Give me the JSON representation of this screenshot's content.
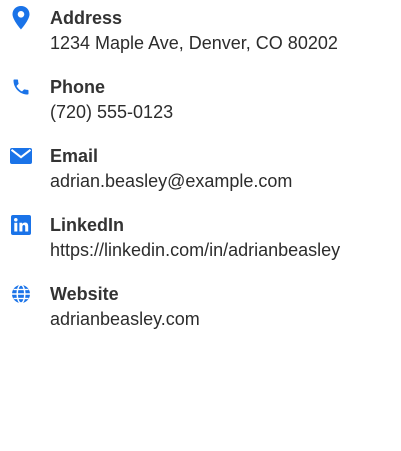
{
  "accent_color": "#1a73e8",
  "contacts": [
    {
      "icon": "location-pin-icon",
      "label": "Address",
      "value": "1234 Maple Ave, Denver, CO 80202"
    },
    {
      "icon": "phone-icon",
      "label": "Phone",
      "value": "(720) 555-0123"
    },
    {
      "icon": "envelope-icon",
      "label": "Email",
      "value": "adrian.beasley@example.com"
    },
    {
      "icon": "linkedin-icon",
      "label": "LinkedIn",
      "value": "https://linkedin.com/in/adrianbeasley"
    },
    {
      "icon": "globe-icon",
      "label": "Website",
      "value": "adrianbeasley.com"
    }
  ]
}
